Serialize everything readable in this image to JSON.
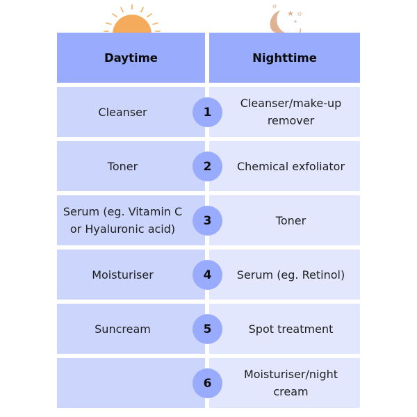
{
  "icons": {
    "day": "sun-icon",
    "night": "moon-and-stars-icon"
  },
  "colors": {
    "header": "#99abfc",
    "day_cell": "#ccd6fd",
    "night_cell": "#e2e7fd",
    "step_circle": "#99abfc",
    "sun": "#f4ac5c",
    "moon": "#deb293"
  },
  "header": {
    "day": "Daytime",
    "night": "Nighttime"
  },
  "steps": [
    {
      "number": "1",
      "day": "Cleanser",
      "night": "Cleanser/make-up remover"
    },
    {
      "number": "2",
      "day": "Toner",
      "night": "Chemical exfoliator"
    },
    {
      "number": "3",
      "day": "Serum (eg. Vitamin C or Hyaluronic acid)",
      "night": "Toner"
    },
    {
      "number": "4",
      "day": "Moisturiser",
      "night": "Serum (eg. Retinol)"
    },
    {
      "number": "5",
      "day": "Suncream",
      "night": "Spot treatment"
    },
    {
      "number": "6",
      "day": "",
      "night": "Moisturiser/night cream"
    }
  ]
}
